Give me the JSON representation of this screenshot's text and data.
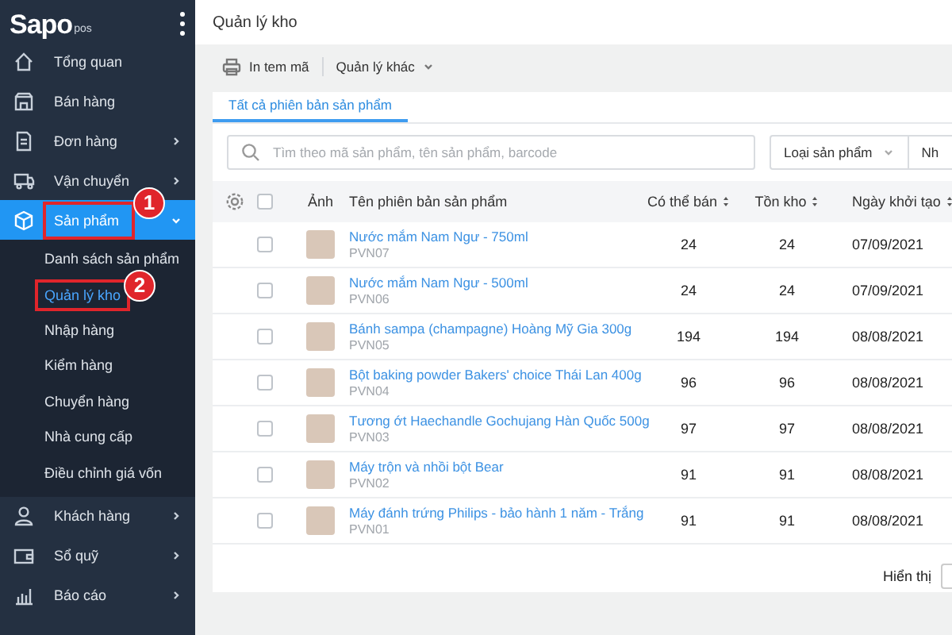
{
  "sidebar": {
    "logo": "Sapo",
    "logo_suffix": "pos",
    "items": [
      {
        "label": "Tổng quan",
        "selected": false,
        "highlighted": false
      },
      {
        "label": "Bán hàng",
        "selected": false,
        "highlighted": false
      },
      {
        "label": "Đơn hàng",
        "expanded": false,
        "selected": false,
        "highlighted": false
      },
      {
        "label": "Vận chuyển",
        "expanded": false,
        "selected": false,
        "highlighted": false
      },
      {
        "label": "Sản phẩm",
        "expanded": true,
        "selected": true,
        "highlighted": true,
        "badge": "1",
        "children": [
          {
            "label": "Danh sách sản phẩm",
            "selected": false,
            "highlighted": false
          },
          {
            "label": "Quản lý kho",
            "selected": true,
            "highlighted": true,
            "badge": "2"
          },
          {
            "label": "Nhập hàng",
            "selected": false,
            "highlighted": false
          },
          {
            "label": "Kiểm hàng",
            "selected": false,
            "highlighted": false
          },
          {
            "label": "Chuyển hàng",
            "selected": false,
            "highlighted": false
          },
          {
            "label": "Nhà cung cấp",
            "selected": false,
            "highlighted": false
          },
          {
            "label": "Điều chỉnh giá vốn",
            "selected": false,
            "highlighted": false
          }
        ]
      },
      {
        "label": "Khách hàng",
        "expanded": false,
        "selected": false,
        "highlighted": false
      },
      {
        "label": "Sổ quỹ",
        "expanded": false,
        "selected": false,
        "highlighted": false
      },
      {
        "label": "Báo cáo",
        "expanded": false,
        "selected": false,
        "highlighted": false
      }
    ]
  },
  "page_title": "Quản lý kho",
  "toolbar": {
    "print_label": "In tem mã",
    "more_label": "Quản lý khác"
  },
  "tabs": [
    {
      "label": "Tất cả phiên bản sản phẩm",
      "selected": true
    }
  ],
  "search": {
    "placeholder": "Tìm theo mã sản phẩm, tên sản phẩm, barcode"
  },
  "filters": [
    "Loại sản phẩm",
    "Nh"
  ],
  "table": {
    "all_checked": false,
    "columns": [
      "Ảnh",
      "Tên phiên bản sản phẩm",
      "Có thể bán",
      "Tồn kho",
      "Ngày khởi tạo"
    ],
    "rows": [
      {
        "checked": false,
        "name": "Nước mắm Nam Ngư - 750ml",
        "sku": "PVN07",
        "available": "24",
        "stock": "24",
        "created": "07/09/2021"
      },
      {
        "checked": false,
        "name": "Nước mắm Nam Ngư - 500ml",
        "sku": "PVN06",
        "available": "24",
        "stock": "24",
        "created": "07/09/2021"
      },
      {
        "checked": false,
        "name": "Bánh sampa (champagne) Hoàng Mỹ Gia 300g",
        "sku": "PVN05",
        "available": "194",
        "stock": "194",
        "created": "08/08/2021"
      },
      {
        "checked": false,
        "name": "Bột baking powder Bakers' choice Thái Lan 400g",
        "sku": "PVN04",
        "available": "96",
        "stock": "96",
        "created": "08/08/2021"
      },
      {
        "checked": false,
        "name": "Tương ớt Haechandle Gochujang Hàn Quốc 500g",
        "sku": "PVN03",
        "available": "97",
        "stock": "97",
        "created": "08/08/2021"
      },
      {
        "checked": false,
        "name": "Máy trộn và nhồi bột Bear",
        "sku": "PVN02",
        "available": "91",
        "stock": "91",
        "created": "08/08/2021"
      },
      {
        "checked": false,
        "name": "Máy đánh trứng Philips - bảo hành 1 năm - Trắng",
        "sku": "PVN01",
        "available": "91",
        "stock": "91",
        "created": "08/08/2021"
      }
    ]
  },
  "footer": {
    "show_label": "Hiển thị"
  }
}
